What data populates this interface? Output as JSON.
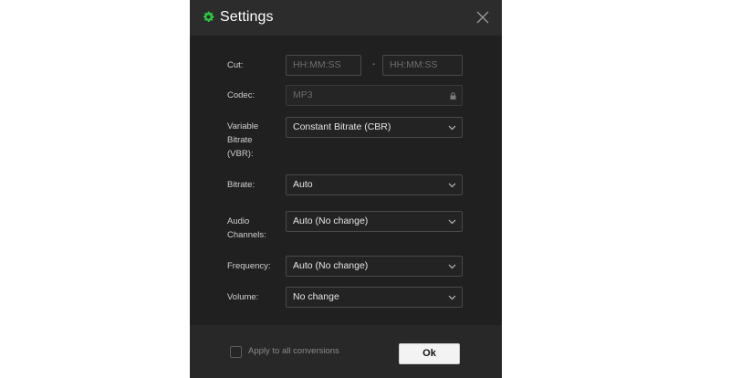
{
  "dialog": {
    "title": "Settings",
    "icons": {
      "title_icon": "gear-icon",
      "close": "close-icon"
    },
    "accent_color": "#2ecc40"
  },
  "form": {
    "cut": {
      "label": "Cut:",
      "start_placeholder": "HH:MM:SS",
      "separator": "-",
      "end_placeholder": "HH:MM:SS"
    },
    "codec": {
      "label": "Codec:",
      "value": "MP3",
      "locked": true
    },
    "vbr": {
      "label_lines": [
        "Variable",
        "Bitrate",
        "(VBR):"
      ],
      "value": "Constant Bitrate (CBR)"
    },
    "bitrate": {
      "label": "Bitrate:",
      "value": "Auto"
    },
    "audio_channels": {
      "label_lines": [
        "Audio",
        "Channels:"
      ],
      "value": "Auto (No change)"
    },
    "frequency": {
      "label": "Frequency:",
      "value": "Auto (No change)"
    },
    "volume": {
      "label": "Volume:",
      "value": "No change"
    }
  },
  "footer": {
    "apply_all_label": "Apply to all conversions",
    "apply_all_checked": false,
    "ok_label": "Ok"
  }
}
